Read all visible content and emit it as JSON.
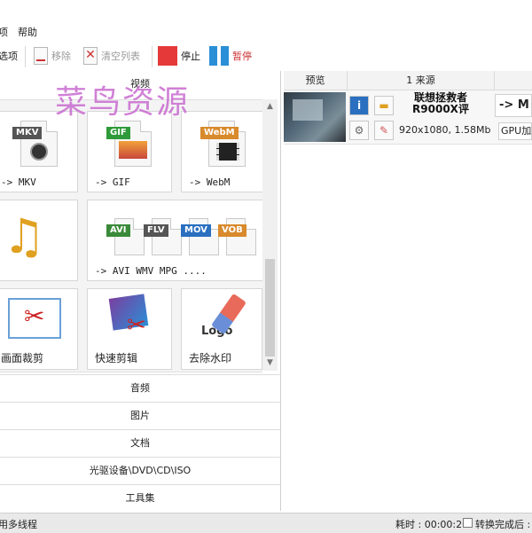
{
  "menu": {
    "items": [
      "项",
      "帮助"
    ]
  },
  "toolbar": {
    "options_label": "选项",
    "remove_label": "移除",
    "clear_label": "清空列表",
    "stop_label": "停止",
    "pause_label": "暂停"
  },
  "watermark": "菜鸟资源",
  "left": {
    "video_header": "视频",
    "tiles": {
      "mkv": {
        "tag": "MKV",
        "label": "-> MKV"
      },
      "gif": {
        "tag": "GIF",
        "label": "-> GIF"
      },
      "webm": {
        "tag": "WebM",
        "label": "-> WebM"
      },
      "multi": {
        "tags": [
          "AVI",
          "FLV",
          "MOV",
          "VOB"
        ],
        "label": "-> AVI WMV MPG ...."
      },
      "crop": {
        "label": "画面裁剪"
      },
      "quick_edit": {
        "label": "快速剪辑"
      },
      "remove_watermark": {
        "label": "去除水印",
        "logo_text": "Logo"
      }
    },
    "categories": [
      "音频",
      "图片",
      "文档",
      "光驱设备\\DVD\\CD\\ISO",
      "工具集"
    ]
  },
  "right": {
    "columns": {
      "preview": "预览",
      "source": "1 来源"
    },
    "task": {
      "title_line1": "联想拯救者",
      "title_line2": "R9000X评",
      "info": "920x1080, 1.58Mb",
      "output": "-> M",
      "gpu": "GPU加"
    }
  },
  "status": {
    "left_text": "用多线程",
    "elapsed": "耗时 : 00:00:20",
    "after_done": "转换完成后 :"
  },
  "colors": {
    "stop": "#e53939",
    "pause": "#2a8fd6",
    "watermark": "#c86bd0",
    "mkv_tag": "#555555",
    "gif_tag": "#2f9a3a",
    "webm_tag": "#d88a2c"
  }
}
